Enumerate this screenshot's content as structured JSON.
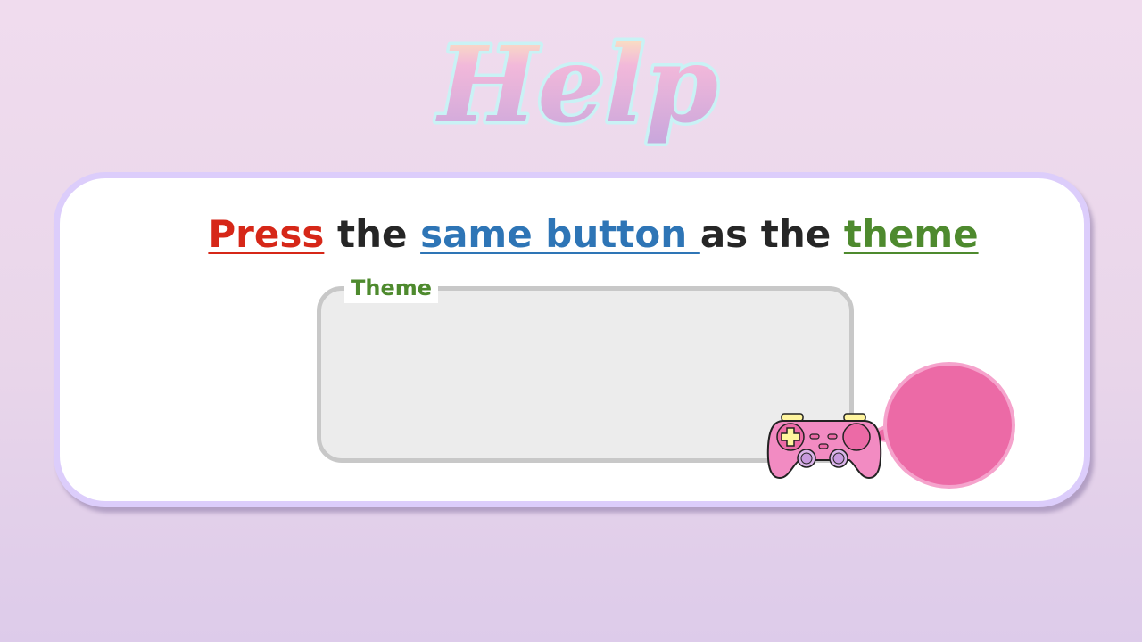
{
  "title": "Help",
  "instruction": {
    "press": "Press",
    "the_1": " the ",
    "same_button": "same button ",
    "as_the": "as the ",
    "theme": "theme"
  },
  "theme_box": {
    "label": "Theme"
  },
  "colors": {
    "press": "#d62718",
    "same_button": "#2e75b6",
    "theme": "#4e8a2e",
    "panel_border": "#dccdfb",
    "bubble_fill": "#ec6aa6",
    "controller_body": "#f28bc2",
    "dpad": "#fff59e"
  },
  "icons": {
    "controller": "gamepad-icon",
    "bubble": "speech-bubble-icon"
  }
}
